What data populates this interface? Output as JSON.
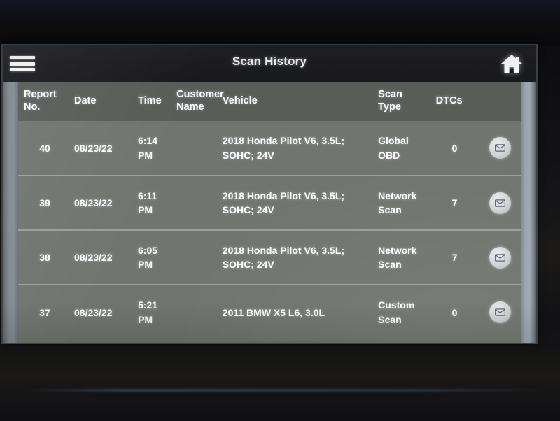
{
  "app": {
    "title": "Scan History",
    "menu_icon": "hamburger-menu-icon",
    "home_icon": "home-icon"
  },
  "table": {
    "columns": [
      {
        "key": "report_no",
        "label": "Report\nNo."
      },
      {
        "key": "date",
        "label": "Date"
      },
      {
        "key": "time",
        "label": "Time"
      },
      {
        "key": "customer_name",
        "label": "Customer\nName"
      },
      {
        "key": "vehicle",
        "label": "Vehicle"
      },
      {
        "key": "scan_type",
        "label": "Scan\nType"
      },
      {
        "key": "dtcs",
        "label": "DTCs"
      },
      {
        "key": "action",
        "label": ""
      }
    ],
    "headers": {
      "report_no_line1": "Report",
      "report_no_line2": "No.",
      "date": "Date",
      "time": "Time",
      "customer_line1": "Customer",
      "customer_line2": "Name",
      "vehicle": "Vehicle",
      "scan_type_line1": "Scan",
      "scan_type_line2": "Type",
      "dtcs": "DTCs"
    },
    "rows": [
      {
        "report_no": "40",
        "date": "08/23/22",
        "time_line1": "6:14",
        "time_line2": "PM",
        "customer_name": "",
        "vehicle_line1": "2018 Honda Pilot V6, 3.5L;",
        "vehicle_line2": "SOHC; 24V",
        "scan_type_line1": "Global",
        "scan_type_line2": "OBD",
        "dtcs": "0",
        "action_icon": "email-envelope-icon"
      },
      {
        "report_no": "39",
        "date": "08/23/22",
        "time_line1": "6:11",
        "time_line2": "PM",
        "customer_name": "",
        "vehicle_line1": "2018 Honda Pilot V6, 3.5L;",
        "vehicle_line2": "SOHC; 24V",
        "scan_type_line1": "Network",
        "scan_type_line2": "Scan",
        "dtcs": "7",
        "action_icon": "email-envelope-icon"
      },
      {
        "report_no": "38",
        "date": "08/23/22",
        "time_line1": "6:05",
        "time_line2": "PM",
        "customer_name": "",
        "vehicle_line1": "2018 Honda Pilot V6, 3.5L;",
        "vehicle_line2": "SOHC; 24V",
        "scan_type_line1": "Network",
        "scan_type_line2": "Scan",
        "dtcs": "7",
        "action_icon": "email-envelope-icon"
      },
      {
        "report_no": "37",
        "date": "08/23/22",
        "time_line1": "5:21",
        "time_line2": "PM",
        "customer_name": "",
        "vehicle_line1": "2011 BMW X5 L6, 3.0L",
        "vehicle_line2": "",
        "scan_type_line1": "Custom",
        "scan_type_line2": "Scan",
        "dtcs": "0",
        "action_icon": "email-envelope-icon"
      }
    ]
  },
  "colors": {
    "title_bar": "#1d1d21",
    "header_row": "#585d58",
    "row_bg": "#70766f",
    "row_divider": "#9aa09a",
    "text": "#ffffff",
    "scrollbar": "#9fa8b1",
    "bezel": "#121214"
  }
}
